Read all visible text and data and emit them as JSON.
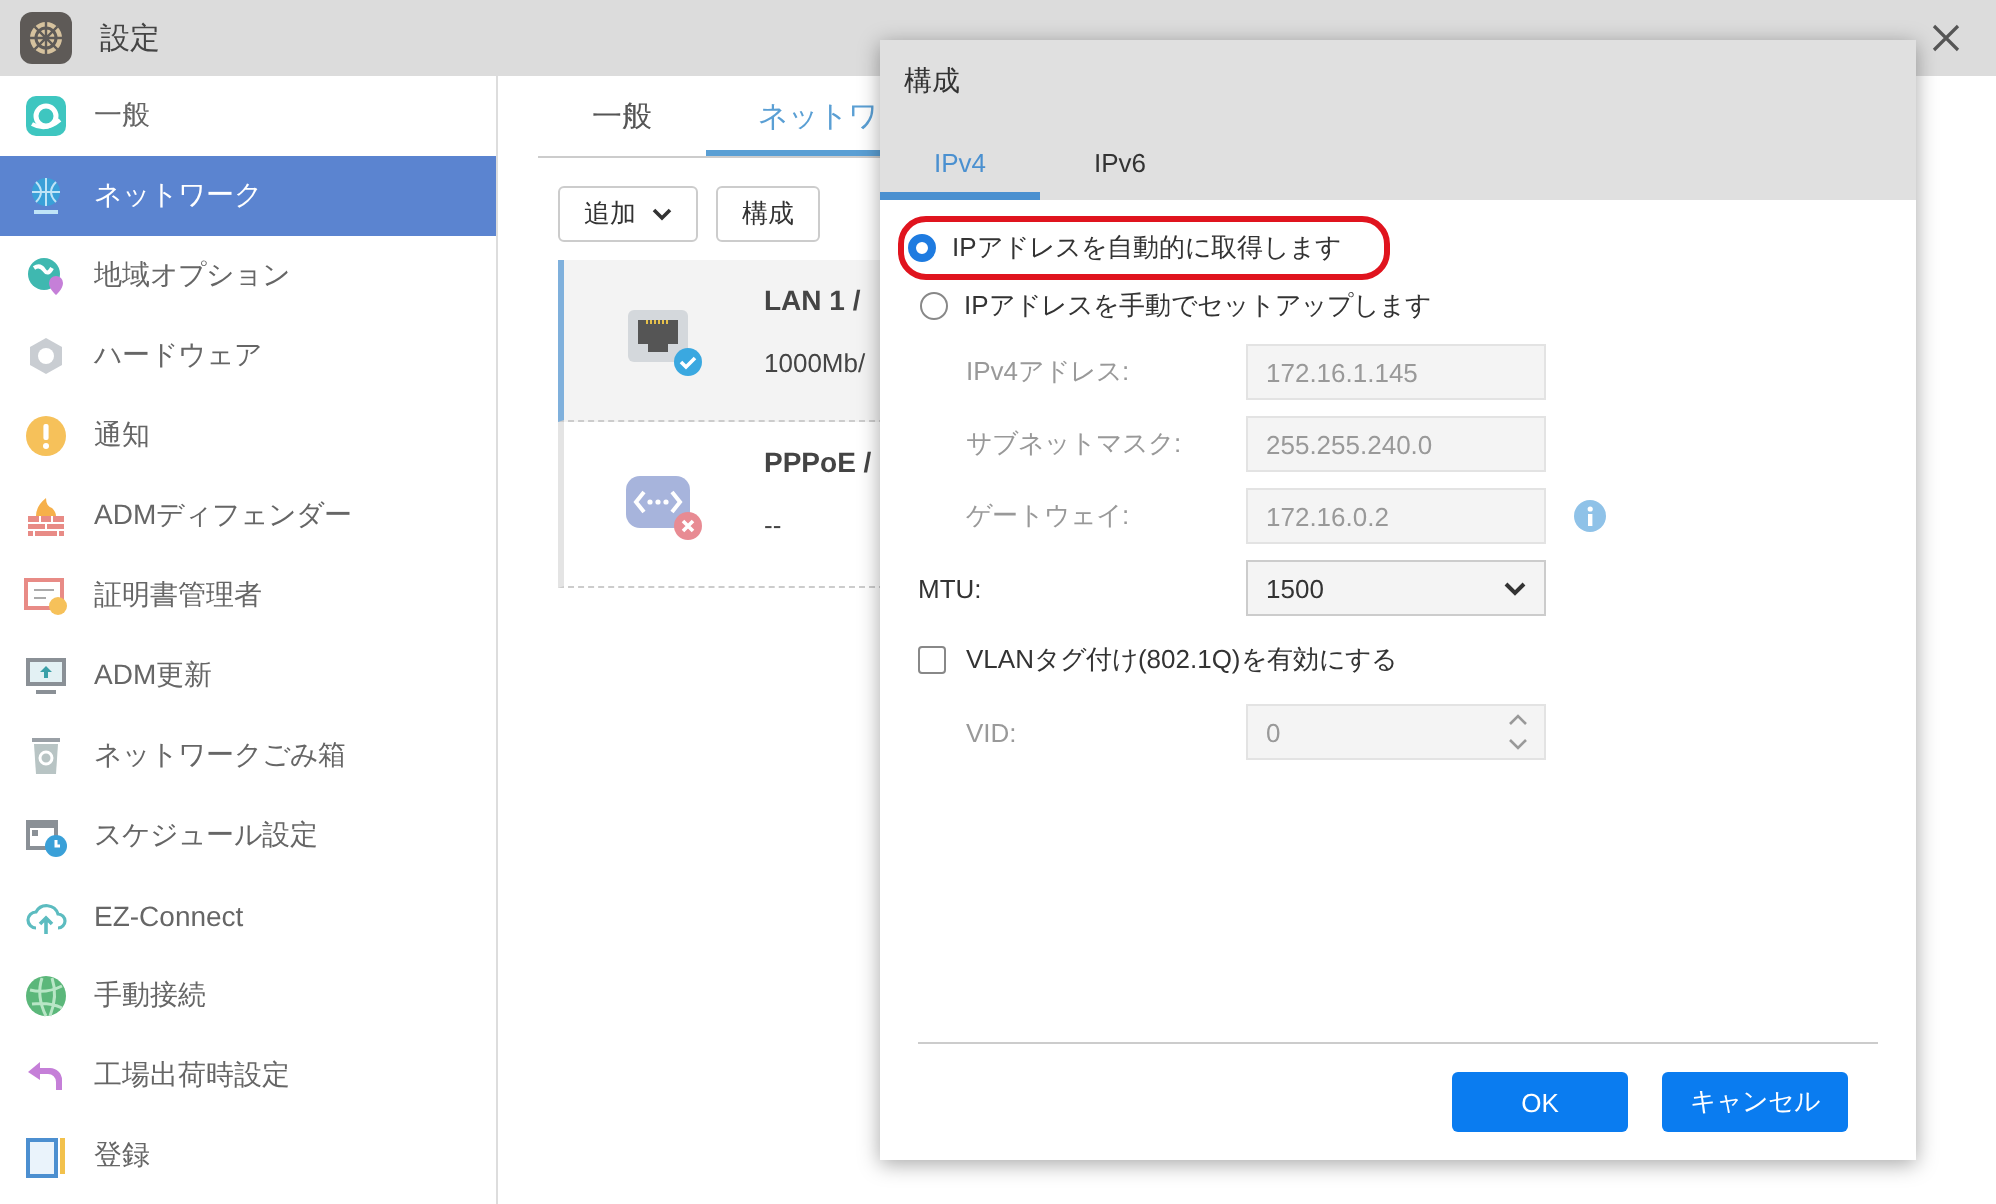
{
  "window": {
    "title": "設定"
  },
  "sidebar": {
    "items": [
      {
        "label": "一般",
        "selected": false
      },
      {
        "label": "ネットワーク",
        "selected": true
      },
      {
        "label": "地域オプション",
        "selected": false
      },
      {
        "label": "ハードウェア",
        "selected": false
      },
      {
        "label": "通知",
        "selected": false
      },
      {
        "label": "ADMディフェンダー",
        "selected": false
      },
      {
        "label": "証明書管理者",
        "selected": false
      },
      {
        "label": "ADM更新",
        "selected": false
      },
      {
        "label": "ネットワークごみ箱",
        "selected": false
      },
      {
        "label": "スケジュール設定",
        "selected": false
      },
      {
        "label": "EZ-Connect",
        "selected": false
      },
      {
        "label": "手動接続",
        "selected": false
      },
      {
        "label": "工場出荷時設定",
        "selected": false
      },
      {
        "label": "登録",
        "selected": false
      }
    ]
  },
  "main": {
    "tabs": [
      {
        "label": "一般",
        "selected": false
      },
      {
        "label": "ネットワ",
        "selected": true
      }
    ],
    "toolbar": [
      {
        "label": "追加",
        "kind": "dropdown"
      },
      {
        "label": "構成",
        "kind": "button"
      }
    ],
    "interfaces": [
      {
        "name": "LAN 1 /",
        "detail": "1000Mb/",
        "kind": "lan",
        "connected": true,
        "selected": true
      },
      {
        "name": "PPPoE /",
        "detail": "--",
        "kind": "pppoe",
        "connected": false,
        "selected": false
      }
    ]
  },
  "dialog": {
    "title": "構成",
    "tabs": [
      {
        "label": "IPv4",
        "selected": true
      },
      {
        "label": "IPv6",
        "selected": false
      }
    ],
    "options": [
      {
        "label": "IPアドレスを自動的に取得します",
        "selected": true,
        "highlighted": true
      },
      {
        "label": "IPアドレスを手動でセットアップします",
        "selected": false,
        "highlighted": false
      }
    ],
    "fields": [
      {
        "label": "IPv4アドレス:",
        "value": "172.16.1.145",
        "disabled": true,
        "info": false
      },
      {
        "label": "サブネットマスク:",
        "value": "255.255.240.0",
        "disabled": true,
        "info": false
      },
      {
        "label": "ゲートウェイ:",
        "value": "172.16.0.2",
        "disabled": true,
        "info": true
      }
    ],
    "mtu": {
      "label": "MTU:",
      "value": "1500"
    },
    "vlan": {
      "label": "VLANタグ付け(802.1Q)を有効にする",
      "checked": false
    },
    "vid": {
      "label": "VID:",
      "value": "0",
      "disabled": true
    },
    "buttons": [
      "OK",
      "キャンセル"
    ]
  }
}
